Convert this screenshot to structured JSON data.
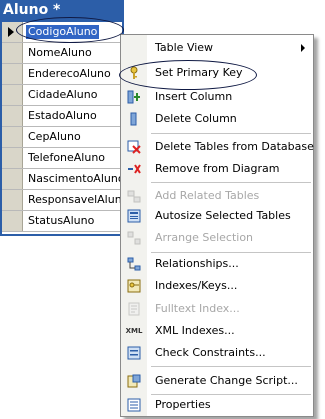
{
  "window": {
    "title": "Aluno *"
  },
  "columns": [
    "CodigoAluno",
    "NomeAluno",
    "EnderecoAluno",
    "CidadeAluno",
    "EstadoAluno",
    "CepAluno",
    "TelefoneAluno",
    "NascimentoAluno",
    "ResponsavelAluno",
    "StatusAluno"
  ],
  "menu": {
    "table_view": "Table View",
    "set_primary_key": "Set Primary Key",
    "insert_column": "Insert Column",
    "delete_column": "Delete Column",
    "delete_tables": "Delete Tables from Database",
    "remove_from_diagram": "Remove from Diagram",
    "add_related_tables": "Add Related Tables",
    "autosize_selected_tables": "Autosize Selected Tables",
    "arrange_selection": "Arrange Selection",
    "relationships": "Relationships...",
    "indexes_keys": "Indexes/Keys...",
    "fulltext_index": "Fulltext Index...",
    "xml_indexes": "XML Indexes...",
    "check_constraints": "Check Constraints...",
    "generate_change_script": "Generate Change Script...",
    "properties": "Properties"
  },
  "icons": {
    "table_view": "blank",
    "set_primary_key": "key-icon",
    "insert_column": "insert-column-icon",
    "delete_column": "delete-column-icon",
    "delete_tables": "delete-table-icon",
    "remove_from_diagram": "remove-diagram-icon",
    "add_related_tables": "related-tables-icon",
    "autosize_selected_tables": "autosize-icon",
    "arrange_selection": "arrange-icon",
    "relationships": "relationships-icon",
    "indexes_keys": "indexes-icon",
    "fulltext_index": "fulltext-icon",
    "xml_indexes": "xml-icon",
    "check_constraints": "constraints-icon",
    "generate_change_script": "script-icon",
    "properties": "properties-icon"
  },
  "colors": {
    "window_blue": "#2c5ea8",
    "selection_blue": "#3165c4",
    "disabled_text": "#a7a7a7",
    "annotation_oval": "#101a44"
  }
}
